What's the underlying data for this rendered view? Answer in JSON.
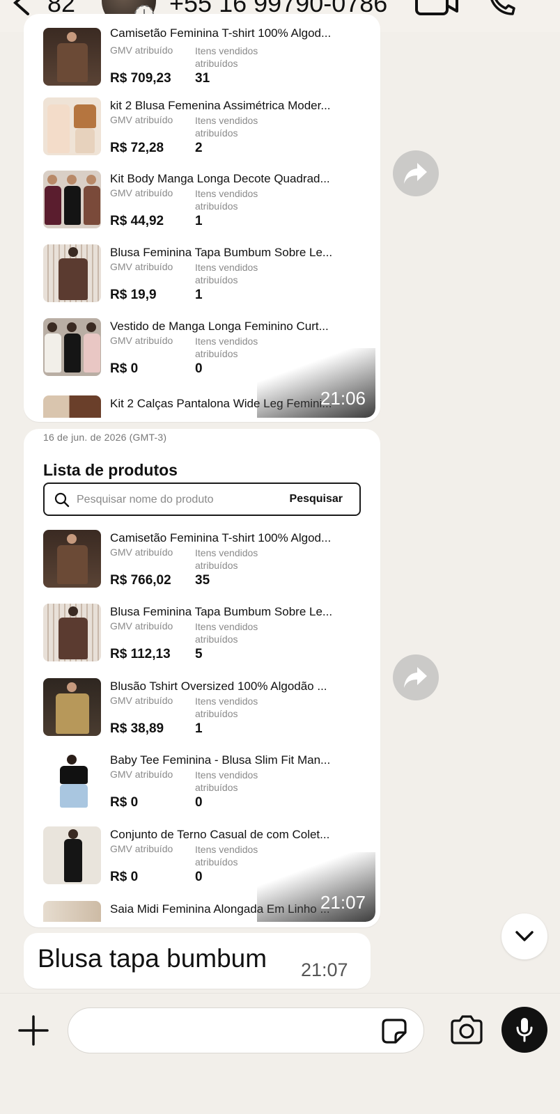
{
  "header": {
    "unread_count": "82",
    "contact_phone": "+55 16 99790-0786"
  },
  "colors": {
    "background": "#f2efea",
    "bubble": "#ffffff",
    "forward_button": "#cbcac8",
    "mic_button": "#111111"
  },
  "messages": [
    {
      "time": "21:06",
      "products": [
        {
          "name": "Camisetão Feminina T-shirt 100% Algod...",
          "gmv_label": "GMV atribuído",
          "items_label": "Itens vendidos atribuídos",
          "gmv": "R$ 709,23",
          "items": "31"
        },
        {
          "name": "kit 2 Blusa Femenina Assimétrica Moder...",
          "gmv_label": "GMV atribuído",
          "items_label": "Itens vendidos atribuídos",
          "gmv": "R$ 72,28",
          "items": "2"
        },
        {
          "name": "Kit Body Manga Longa Decote Quadrad...",
          "gmv_label": "GMV atribuído",
          "items_label": "Itens vendidos atribuídos",
          "gmv": "R$ 44,92",
          "items": "1"
        },
        {
          "name": "Blusa Feminina Tapa Bumbum Sobre Le...",
          "gmv_label": "GMV atribuído",
          "items_label": "Itens vendidos atribuídos",
          "gmv": "R$ 19,9",
          "items": "1"
        },
        {
          "name": "Vestido de Manga Longa Feminino Curt...",
          "gmv_label": "GMV atribuído",
          "items_label": "Itens vendidos atribuídos",
          "gmv": "R$ 0",
          "items": "0"
        },
        {
          "name": "Kit 2 Calças Pantalona Wide Leg Femini..."
        }
      ]
    },
    {
      "date": "16 de jun. de 2026 (GMT-3)",
      "list_title": "Lista de produtos",
      "search_placeholder": "Pesquisar nome do produto",
      "search_button": "Pesquisar",
      "time": "21:07",
      "products": [
        {
          "name": "Camisetão Feminina T-shirt 100% Algod...",
          "gmv_label": "GMV atribuído",
          "items_label": "Itens vendidos atribuídos",
          "gmv": "R$ 766,02",
          "items": "35"
        },
        {
          "name": "Blusa Feminina Tapa Bumbum Sobre Le...",
          "gmv_label": "GMV atribuído",
          "items_label": "Itens vendidos atribuídos",
          "gmv": "R$ 112,13",
          "items": "5"
        },
        {
          "name": "Blusão Tshirt Oversized 100% Algodão ...",
          "gmv_label": "GMV atribuído",
          "items_label": "Itens vendidos atribuídos",
          "gmv": "R$ 38,89",
          "items": "1"
        },
        {
          "name": "Baby Tee Feminina - Blusa Slim Fit Man...",
          "gmv_label": "GMV atribuído",
          "items_label": "Itens vendidos atribuídos",
          "gmv": "R$ 0",
          "items": "0"
        },
        {
          "name": "Conjunto de Terno Casual de com Colet...",
          "gmv_label": "GMV atribuído",
          "items_label": "Itens vendidos atribuídos",
          "gmv": "R$ 0",
          "items": "0"
        },
        {
          "name": "Saia Midi Feminina Alongada Em Linho ..."
        }
      ]
    },
    {
      "text": "Blusa tapa bumbum",
      "time": "21:07"
    }
  ],
  "icons": {
    "back": "chevron-left-icon",
    "status": "status-ring-icon",
    "video": "video-call-icon",
    "call": "phone-icon",
    "forward": "forward-icon",
    "scroll_down": "chevron-down-icon",
    "attach": "plus-icon",
    "sticker": "sticker-icon",
    "camera": "camera-icon",
    "mic": "microphone-icon"
  }
}
